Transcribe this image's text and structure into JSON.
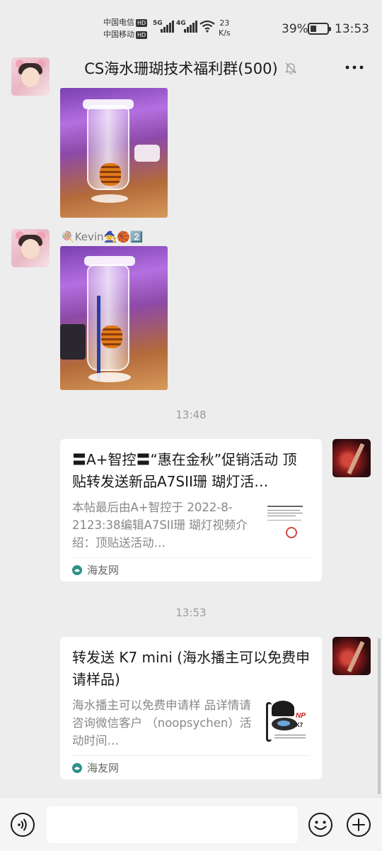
{
  "status_bar": {
    "carrier1": "中国电信",
    "carrier2": "中国移动",
    "hd_badge": "HD",
    "sig1_label": "5G",
    "sig2_label": "4G",
    "net_speed_value": "23",
    "net_speed_unit": "K/s",
    "battery_pct": "39%",
    "time": "13:53"
  },
  "header": {
    "title": "CS海水珊瑚技术福利群(500)"
  },
  "messages": {
    "sender_name": "🍭Kevin🧙🏀2️⃣",
    "time1": "13:48",
    "time2": "13:53",
    "card1": {
      "title": "〓A+智控〓“惠在金秋”促销活动 顶贴转发送新品A7SII珊 瑚灯活…",
      "desc": "本帖最后由A+智控于 2022-8-2123:38编辑A7SII珊 瑚灯视频介绍：顶贴送活动…",
      "source": "海友网"
    },
    "card2": {
      "title": "转发送 K7 mini (海水播主可以免费申请样品)",
      "desc": "海水播主可以免费申请样 品详情请咨询微信客户 （noopsychen）活动时间…",
      "source": "海友网",
      "thumb_brand": "NP",
      "thumb_model": "K7"
    }
  },
  "input": {
    "placeholder": ""
  }
}
